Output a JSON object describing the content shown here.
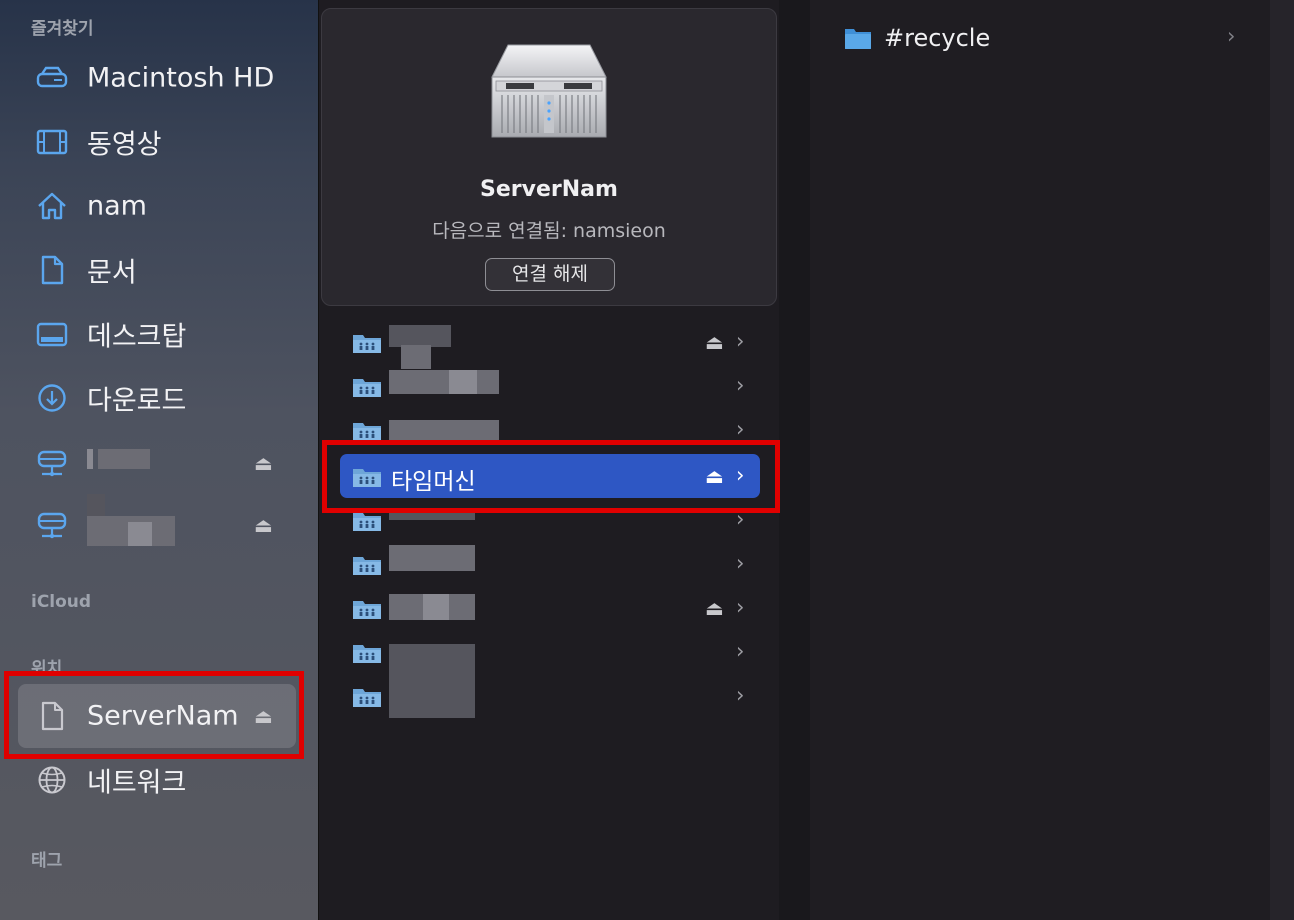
{
  "sidebar": {
    "favorites_header": "즐겨찾기",
    "favorites": [
      {
        "label": "Macintosh HD",
        "icon": "disk-icon"
      },
      {
        "label": "동영상",
        "icon": "film-icon"
      },
      {
        "label": "nam",
        "icon": "home-icon"
      },
      {
        "label": "문서",
        "icon": "document-icon"
      },
      {
        "label": "데스크탑",
        "icon": "desktop-icon"
      },
      {
        "label": "다운로드",
        "icon": "download-icon"
      },
      {
        "label": "",
        "icon": "network-drive-icon",
        "ejectable": true
      },
      {
        "label": "",
        "icon": "network-drive-icon",
        "ejectable": true
      }
    ],
    "icloud_header": "iCloud",
    "locations_header": "위치",
    "locations": [
      {
        "label": "ServerNam",
        "icon": "document-icon",
        "ejectable": true,
        "selected": true
      },
      {
        "label": "네트워크",
        "icon": "globe-icon"
      }
    ],
    "tags_header": "태그"
  },
  "server": {
    "name": "ServerNam",
    "connected_as": "다음으로 연결됨: namsieon",
    "disconnect_label": "연결 해제",
    "icon": "server-rack-icon"
  },
  "shares": [
    {
      "label": "",
      "ejectable": true
    },
    {
      "label": "",
      "ejectable": false
    },
    {
      "label": "",
      "ejectable": false
    },
    {
      "label": "타임머신",
      "ejectable": true,
      "selected": true
    },
    {
      "label": "",
      "ejectable": false
    },
    {
      "label": "",
      "ejectable": false
    },
    {
      "label": "",
      "ejectable": true
    },
    {
      "label": "",
      "ejectable": false
    },
    {
      "label": "",
      "ejectable": false
    }
  ],
  "contents": [
    {
      "label": "#recycle",
      "icon": "folder-icon"
    }
  ],
  "glyphs": {
    "eject": "⏏",
    "chevron": "›"
  },
  "colors": {
    "accent": "#2e57c4",
    "highlight_box": "#e00000",
    "folder_blue": "#5aa8e8"
  }
}
